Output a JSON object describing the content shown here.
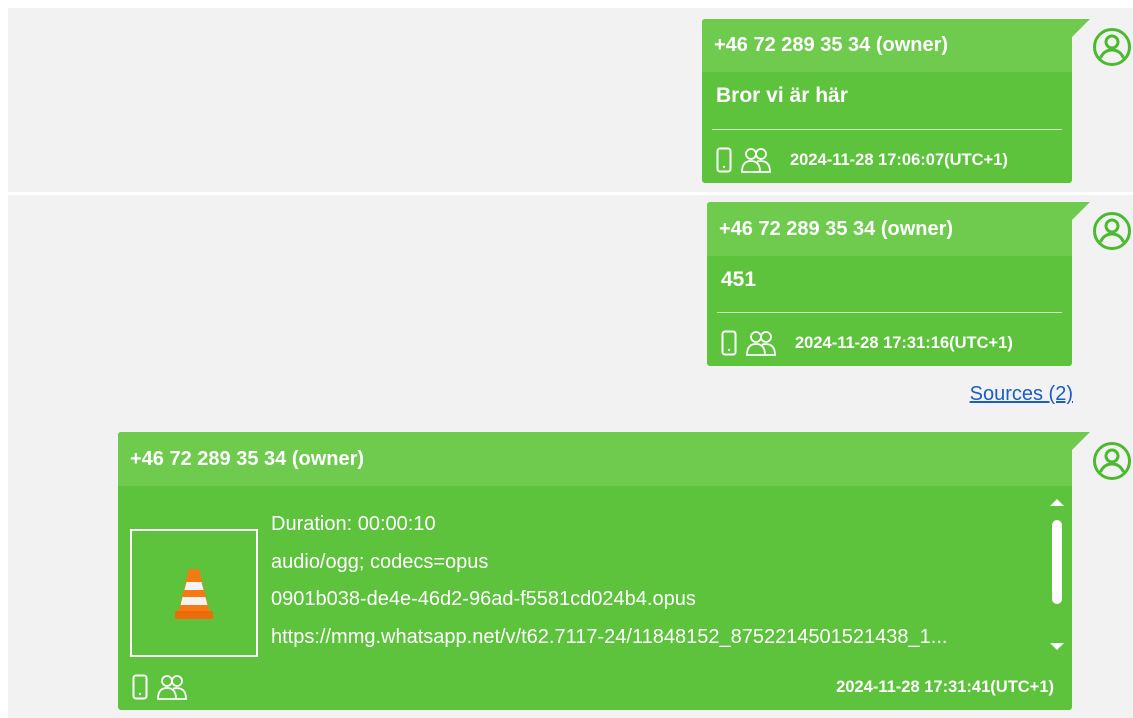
{
  "messages": [
    {
      "sender": "+46 72 289 35 34 (owner)",
      "text": "Bror vi är här",
      "timestamp": "2024-11-28 17:06:07(UTC+1)"
    },
    {
      "sender": "+46 72 289 35 34 (owner)",
      "text": "451",
      "timestamp": "2024-11-28 17:31:16(UTC+1)"
    },
    {
      "sender": "+46 72 289 35 34 (owner)",
      "attachment": {
        "duration": "Duration: 00:00:10",
        "mime": "audio/ogg; codecs=opus",
        "filename": "0901b038-de4e-46d2-96ad-f5581cd024b4.opus",
        "url": "https://mmg.whatsapp.net/v/t62.7117-24/11848152_8752214501521438_1..."
      },
      "timestamp": "2024-11-28 17:31:41(UTC+1)"
    }
  ],
  "sources_link": "Sources (2)",
  "colors": {
    "bubble": "#5dc23c",
    "bubble_header": "#6ecb4e",
    "row_background": "#f2f2f2",
    "link": "#1a5cc8",
    "avatar": "#4cb92f"
  },
  "icons": {
    "device": "phone-icon",
    "group": "group-icon",
    "avatar": "user-avatar-icon",
    "media": "vlc-cone-icon"
  }
}
